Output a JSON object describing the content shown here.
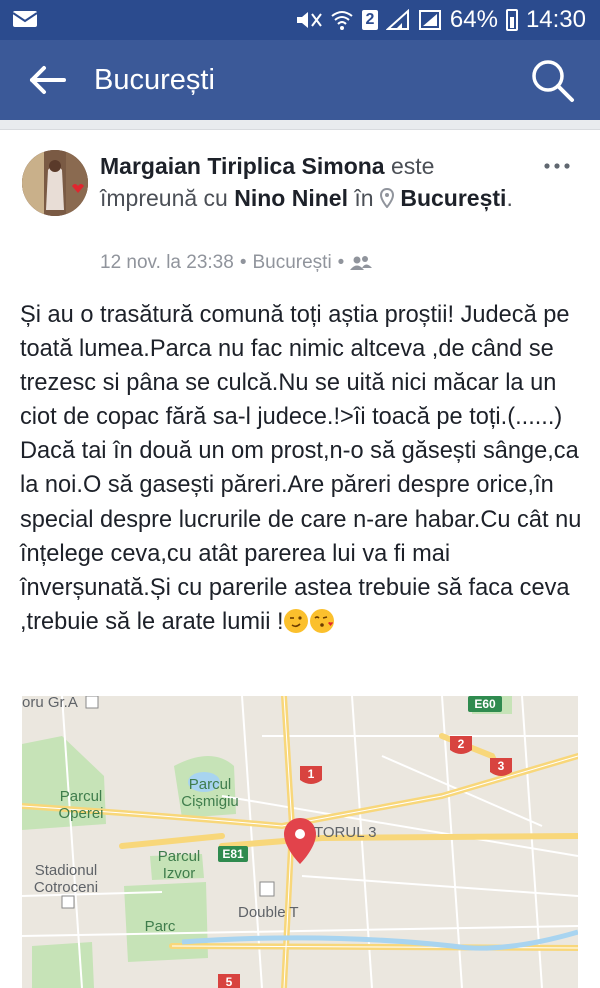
{
  "status_bar": {
    "battery": "64%",
    "time": "14:30",
    "sim": "2"
  },
  "app_bar": {
    "title": "București"
  },
  "post": {
    "author": "Margaian Tiriplica Simona",
    "with_text": "este împreună cu",
    "tagged": "Nino Ninel",
    "in_text": "în",
    "location": "București",
    "date": "12 nov. la 23:38",
    "meta_location": "București",
    "separator": "•",
    "body": "Și au o trasătură comună toți aștia proștii! Judecă pe toată lumea.Parca nu fac nimic altceva ,de când se trezesc si pâna se culcă.Nu se uită nici măcar la un ciot de copac fără  sa-l judece.!>îi toacă pe toți.(......) Dacă tai în două un om prost,n-o să găsești sânge,ca la noi.O să gasești păreri.Are păreri despre orice,în special despre lucrurile de care n-are habar.Cu cât nu înțelege ceva,cu atât parerea lui va fi mai înverșunată.Și cu parerile astea trebuie să faca ceva ,trebuie să le arate lumii !"
  },
  "map": {
    "labels": {
      "top_left": "oru Gr.A",
      "parc_operei": "Parcul Operei",
      "parc_cismigiu": "Parcul Cișmigiu",
      "stadion": "Stadionul Cotroceni",
      "parc_izvor": "Parcul Izvor",
      "parc": "Parc",
      "torul": "TORUL 3",
      "double_t": "Double T",
      "e81": "E81",
      "e60": "E60",
      "r1": "1",
      "r2": "2",
      "r3": "3",
      "r5": "5"
    },
    "colors": {
      "pin": "#e2434b",
      "park": "#c6e3b7",
      "road": "#f8d77a"
    }
  }
}
